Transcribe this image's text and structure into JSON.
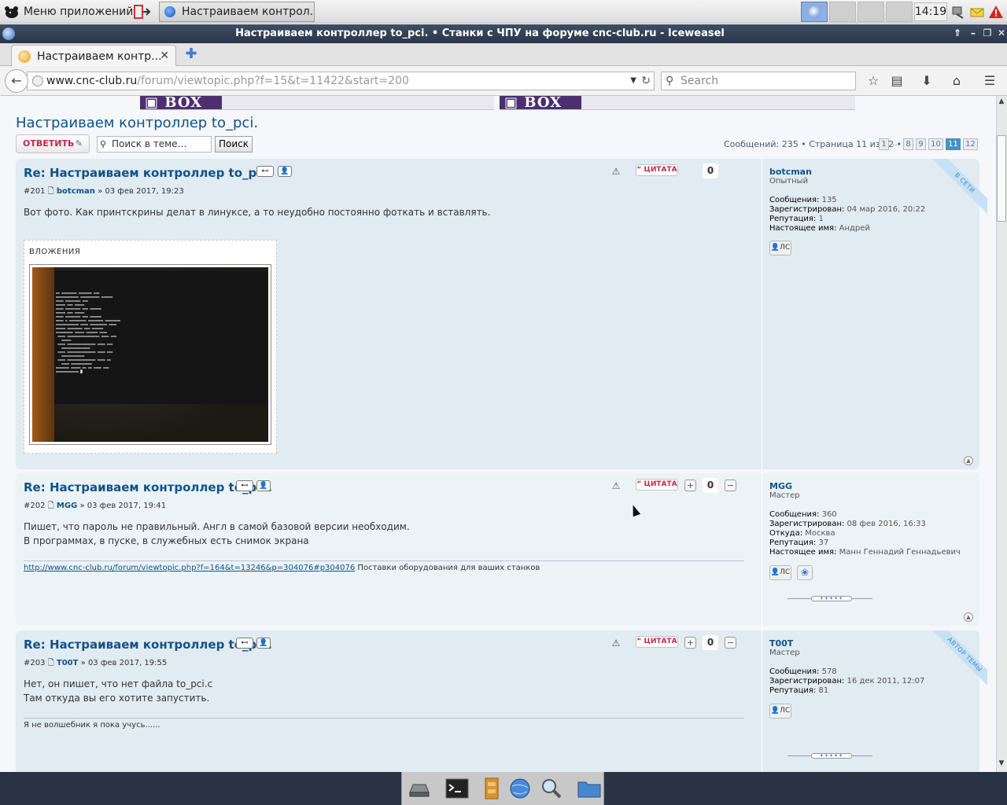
{
  "taskbar": {
    "apps_menu": "Меню приложений",
    "window_button": "Настраиваем контрол...",
    "clock": "14:19"
  },
  "window": {
    "title": "Настраиваем контроллер to_pci. • Станки с ЧПУ на форуме cnc-club.ru - Iceweasel"
  },
  "browser": {
    "tab_title": "Настраиваем контр...",
    "url_host": "www.cnc-club.ru",
    "url_path": "/forum/viewtopic.php?f=15&t=11422&start=200",
    "search_placeholder": "Search"
  },
  "topic": {
    "title": "Настраиваем контроллер to_pci.",
    "reply_label": "ОТВЕТИТЬ",
    "search_placeholder": "Поиск в теме…",
    "search_button": "Поиск",
    "pager_info": "Сообщений: 235 • Страница 11 из 12 •",
    "pages": [
      "1",
      "…",
      "8",
      "9",
      "10",
      "11",
      "12"
    ],
    "active_page": "11"
  },
  "labels": {
    "quote": "ЦИТАТА",
    "pm": "ЛС",
    "posts": "Сообщения:",
    "registered": "Зарегистрирован:",
    "from": "Откуда:",
    "reputation": "Репутация:",
    "real_name": "Настоящее имя:",
    "attachments": "ВЛОЖЕНИЯ"
  },
  "posts": [
    {
      "title": "Re: Настраиваем контроллер to_pci.",
      "number": "#201",
      "author": "botcman",
      "date": "» 03 фев 2017, 19:23",
      "body": "Вот фото. Как принтскрины делат в линуксе, а то неудобно постоянно фоткать и вставлять.",
      "rep": "0",
      "rank": "Опытный",
      "posts_count": "135",
      "registered": "04 мар 2016, 20:22",
      "reputation": "1",
      "real_name": "Андрей",
      "ribbon": "В СЕТИ"
    },
    {
      "title": "Re: Настраиваем контроллер to_pci.",
      "number": "#202",
      "author": "MGG",
      "date": "» 03 фев 2017, 19:41",
      "body_line1": "Пишет, что пароль не правильный. Англ в самой базовой версии необходим.",
      "body_line2": "В программах, в пуске, в служебных есть снимок экрана",
      "sig_link": "http://www.cnc-club.ru/forum/viewtopic.php?f=164&t=13246&p=304076#p304076",
      "sig_text": " Поставки оборудования для ваших станков",
      "rep": "0",
      "rank": "Мастер",
      "posts_count": "360",
      "registered": "08 фев 2016, 16:33",
      "from": "Москва",
      "reputation": "37",
      "real_name": "Манн Геннадий Геннадьевич"
    },
    {
      "title": "Re: Настраиваем контроллер to_pci.",
      "number": "#203",
      "author": "T00T",
      "date": "» 03 фев 2017, 19:55",
      "body_line1": "Нет, он пишет, что нет файла to_pci.c",
      "body_line2": "Там откуда вы его хотите запустить.",
      "sig_text": "Я не волшебник я пока учусь......",
      "rep": "0",
      "rank": "Мастер",
      "posts_count": "578",
      "registered": "16 дек 2011, 12:07",
      "reputation": "81",
      "ribbon": "АВТОР ТЕМЫ"
    }
  ],
  "colors": {
    "link": "#105289",
    "post_bg1": "#e1ebf2",
    "post_bg2": "#ecf3f7",
    "quote_red": "#bc2a4d",
    "active_page": "#4692bf"
  }
}
